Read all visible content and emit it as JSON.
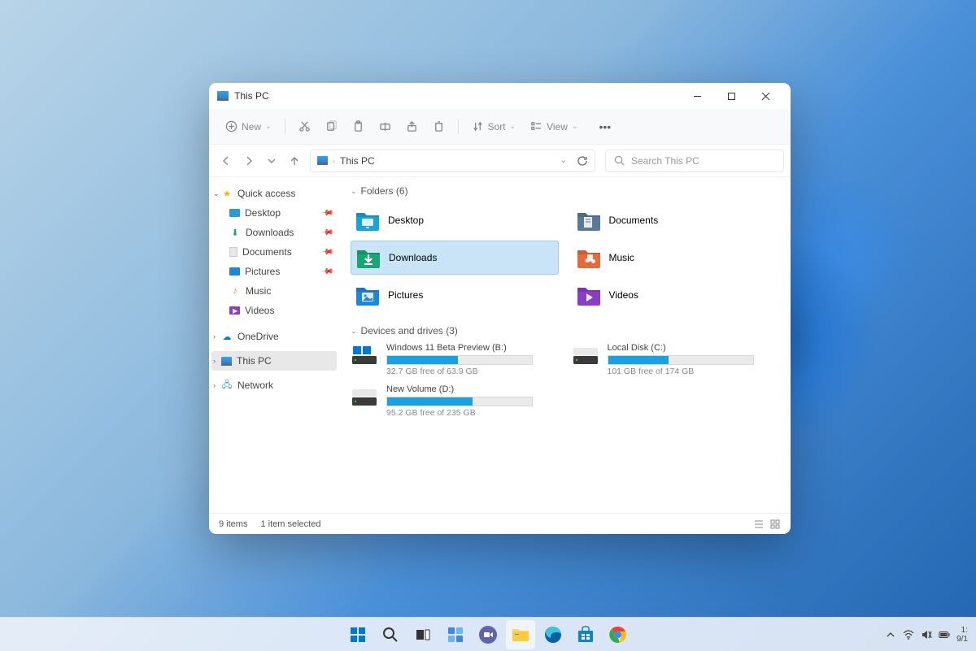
{
  "window": {
    "title": "This PC"
  },
  "toolbar": {
    "new": "New",
    "sort": "Sort",
    "view": "View"
  },
  "address": {
    "location": "This PC"
  },
  "search": {
    "placeholder": "Search This PC"
  },
  "sidebar": {
    "quick_access": "Quick access",
    "items": [
      {
        "label": "Desktop"
      },
      {
        "label": "Downloads"
      },
      {
        "label": "Documents"
      },
      {
        "label": "Pictures"
      },
      {
        "label": "Music"
      },
      {
        "label": "Videos"
      }
    ],
    "onedrive": "OneDrive",
    "this_pc": "This PC",
    "network": "Network"
  },
  "sections": {
    "folders": "Folders (6)",
    "drives": "Devices and drives (3)"
  },
  "folders": [
    {
      "label": "Desktop",
      "color": "#1ba3d9"
    },
    {
      "label": "Documents",
      "color": "#5a7a95"
    },
    {
      "label": "Downloads",
      "color": "#1aa574"
    },
    {
      "label": "Music",
      "color": "#e56b3e"
    },
    {
      "label": "Pictures",
      "color": "#1e88d6"
    },
    {
      "label": "Videos",
      "color": "#8b3dc4"
    }
  ],
  "drives": [
    {
      "label": "Windows 11 Beta Preview (B:)",
      "free": "32.7 GB free of 63.9 GB",
      "used_pct": 49
    },
    {
      "label": "Local Disk (C:)",
      "free": "101 GB free of 174 GB",
      "used_pct": 42
    },
    {
      "label": "New Volume (D:)",
      "free": "95.2 GB free of 235 GB",
      "used_pct": 59
    }
  ],
  "status": {
    "items": "9 items",
    "selected": "1 item selected"
  },
  "tray": {
    "time": "1:",
    "date": "9/1"
  }
}
